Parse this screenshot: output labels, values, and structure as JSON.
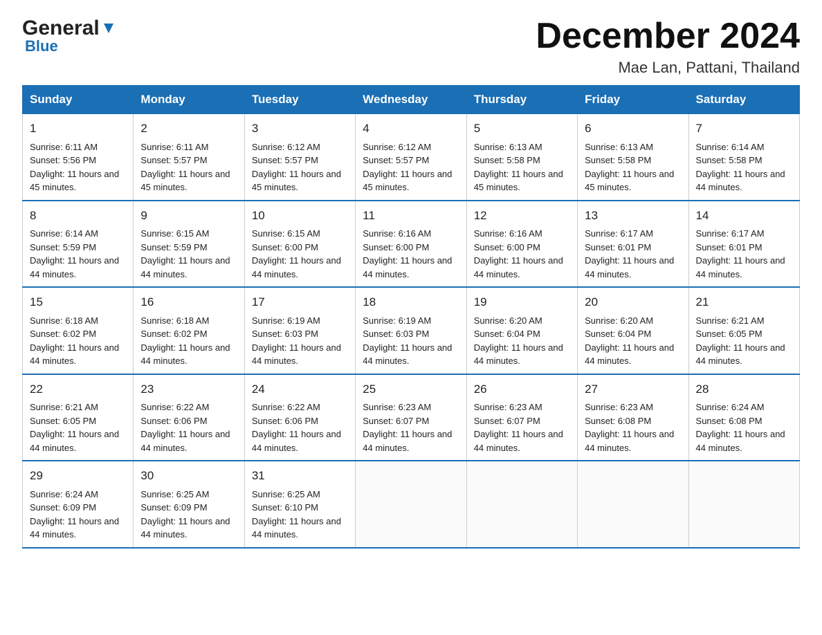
{
  "header": {
    "logo_general": "General",
    "logo_blue": "Blue",
    "month_title": "December 2024",
    "location": "Mae Lan, Pattani, Thailand"
  },
  "days_of_week": [
    "Sunday",
    "Monday",
    "Tuesday",
    "Wednesday",
    "Thursday",
    "Friday",
    "Saturday"
  ],
  "weeks": [
    [
      {
        "day": "1",
        "sunrise": "6:11 AM",
        "sunset": "5:56 PM",
        "daylight": "11 hours and 45 minutes."
      },
      {
        "day": "2",
        "sunrise": "6:11 AM",
        "sunset": "5:57 PM",
        "daylight": "11 hours and 45 minutes."
      },
      {
        "day": "3",
        "sunrise": "6:12 AM",
        "sunset": "5:57 PM",
        "daylight": "11 hours and 45 minutes."
      },
      {
        "day": "4",
        "sunrise": "6:12 AM",
        "sunset": "5:57 PM",
        "daylight": "11 hours and 45 minutes."
      },
      {
        "day": "5",
        "sunrise": "6:13 AM",
        "sunset": "5:58 PM",
        "daylight": "11 hours and 45 minutes."
      },
      {
        "day": "6",
        "sunrise": "6:13 AM",
        "sunset": "5:58 PM",
        "daylight": "11 hours and 45 minutes."
      },
      {
        "day": "7",
        "sunrise": "6:14 AM",
        "sunset": "5:58 PM",
        "daylight": "11 hours and 44 minutes."
      }
    ],
    [
      {
        "day": "8",
        "sunrise": "6:14 AM",
        "sunset": "5:59 PM",
        "daylight": "11 hours and 44 minutes."
      },
      {
        "day": "9",
        "sunrise": "6:15 AM",
        "sunset": "5:59 PM",
        "daylight": "11 hours and 44 minutes."
      },
      {
        "day": "10",
        "sunrise": "6:15 AM",
        "sunset": "6:00 PM",
        "daylight": "11 hours and 44 minutes."
      },
      {
        "day": "11",
        "sunrise": "6:16 AM",
        "sunset": "6:00 PM",
        "daylight": "11 hours and 44 minutes."
      },
      {
        "day": "12",
        "sunrise": "6:16 AM",
        "sunset": "6:00 PM",
        "daylight": "11 hours and 44 minutes."
      },
      {
        "day": "13",
        "sunrise": "6:17 AM",
        "sunset": "6:01 PM",
        "daylight": "11 hours and 44 minutes."
      },
      {
        "day": "14",
        "sunrise": "6:17 AM",
        "sunset": "6:01 PM",
        "daylight": "11 hours and 44 minutes."
      }
    ],
    [
      {
        "day": "15",
        "sunrise": "6:18 AM",
        "sunset": "6:02 PM",
        "daylight": "11 hours and 44 minutes."
      },
      {
        "day": "16",
        "sunrise": "6:18 AM",
        "sunset": "6:02 PM",
        "daylight": "11 hours and 44 minutes."
      },
      {
        "day": "17",
        "sunrise": "6:19 AM",
        "sunset": "6:03 PM",
        "daylight": "11 hours and 44 minutes."
      },
      {
        "day": "18",
        "sunrise": "6:19 AM",
        "sunset": "6:03 PM",
        "daylight": "11 hours and 44 minutes."
      },
      {
        "day": "19",
        "sunrise": "6:20 AM",
        "sunset": "6:04 PM",
        "daylight": "11 hours and 44 minutes."
      },
      {
        "day": "20",
        "sunrise": "6:20 AM",
        "sunset": "6:04 PM",
        "daylight": "11 hours and 44 minutes."
      },
      {
        "day": "21",
        "sunrise": "6:21 AM",
        "sunset": "6:05 PM",
        "daylight": "11 hours and 44 minutes."
      }
    ],
    [
      {
        "day": "22",
        "sunrise": "6:21 AM",
        "sunset": "6:05 PM",
        "daylight": "11 hours and 44 minutes."
      },
      {
        "day": "23",
        "sunrise": "6:22 AM",
        "sunset": "6:06 PM",
        "daylight": "11 hours and 44 minutes."
      },
      {
        "day": "24",
        "sunrise": "6:22 AM",
        "sunset": "6:06 PM",
        "daylight": "11 hours and 44 minutes."
      },
      {
        "day": "25",
        "sunrise": "6:23 AM",
        "sunset": "6:07 PM",
        "daylight": "11 hours and 44 minutes."
      },
      {
        "day": "26",
        "sunrise": "6:23 AM",
        "sunset": "6:07 PM",
        "daylight": "11 hours and 44 minutes."
      },
      {
        "day": "27",
        "sunrise": "6:23 AM",
        "sunset": "6:08 PM",
        "daylight": "11 hours and 44 minutes."
      },
      {
        "day": "28",
        "sunrise": "6:24 AM",
        "sunset": "6:08 PM",
        "daylight": "11 hours and 44 minutes."
      }
    ],
    [
      {
        "day": "29",
        "sunrise": "6:24 AM",
        "sunset": "6:09 PM",
        "daylight": "11 hours and 44 minutes."
      },
      {
        "day": "30",
        "sunrise": "6:25 AM",
        "sunset": "6:09 PM",
        "daylight": "11 hours and 44 minutes."
      },
      {
        "day": "31",
        "sunrise": "6:25 AM",
        "sunset": "6:10 PM",
        "daylight": "11 hours and 44 minutes."
      },
      null,
      null,
      null,
      null
    ]
  ],
  "labels": {
    "sunrise": "Sunrise:",
    "sunset": "Sunset:",
    "daylight": "Daylight:"
  }
}
